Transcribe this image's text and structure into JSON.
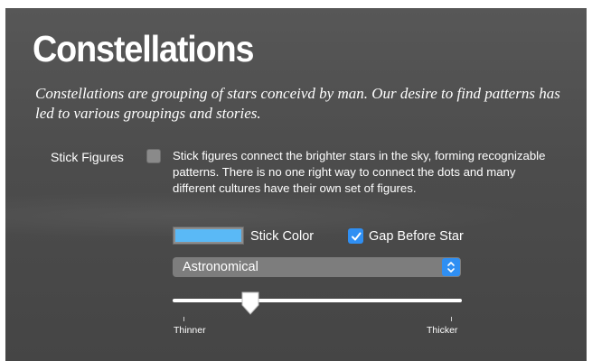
{
  "title": "Constellations",
  "subtitle": "Constellations are grouping of stars conceivd by man. Our desire to find patterns has led to various groupings and stories.",
  "stick_figures": {
    "label": "Stick Figures",
    "checked": false,
    "description": "Stick figures connect the brighter stars in the sky, forming recognizable patterns. There is no one right way to connect the dots and many different cultures have their own set of figures."
  },
  "stick_color": {
    "label": "Stick Color",
    "value": "#5ab9f6"
  },
  "gap_before_star": {
    "label": "Gap Before Star",
    "checked": true
  },
  "figure_set": {
    "selected": "Astronomical"
  },
  "thickness_slider": {
    "value": 0.27,
    "min_label": "Thinner",
    "max_label": "Thicker"
  },
  "icons": {
    "checkmark": "checkmark-icon",
    "stepper": "up-down-chevron-icon"
  }
}
